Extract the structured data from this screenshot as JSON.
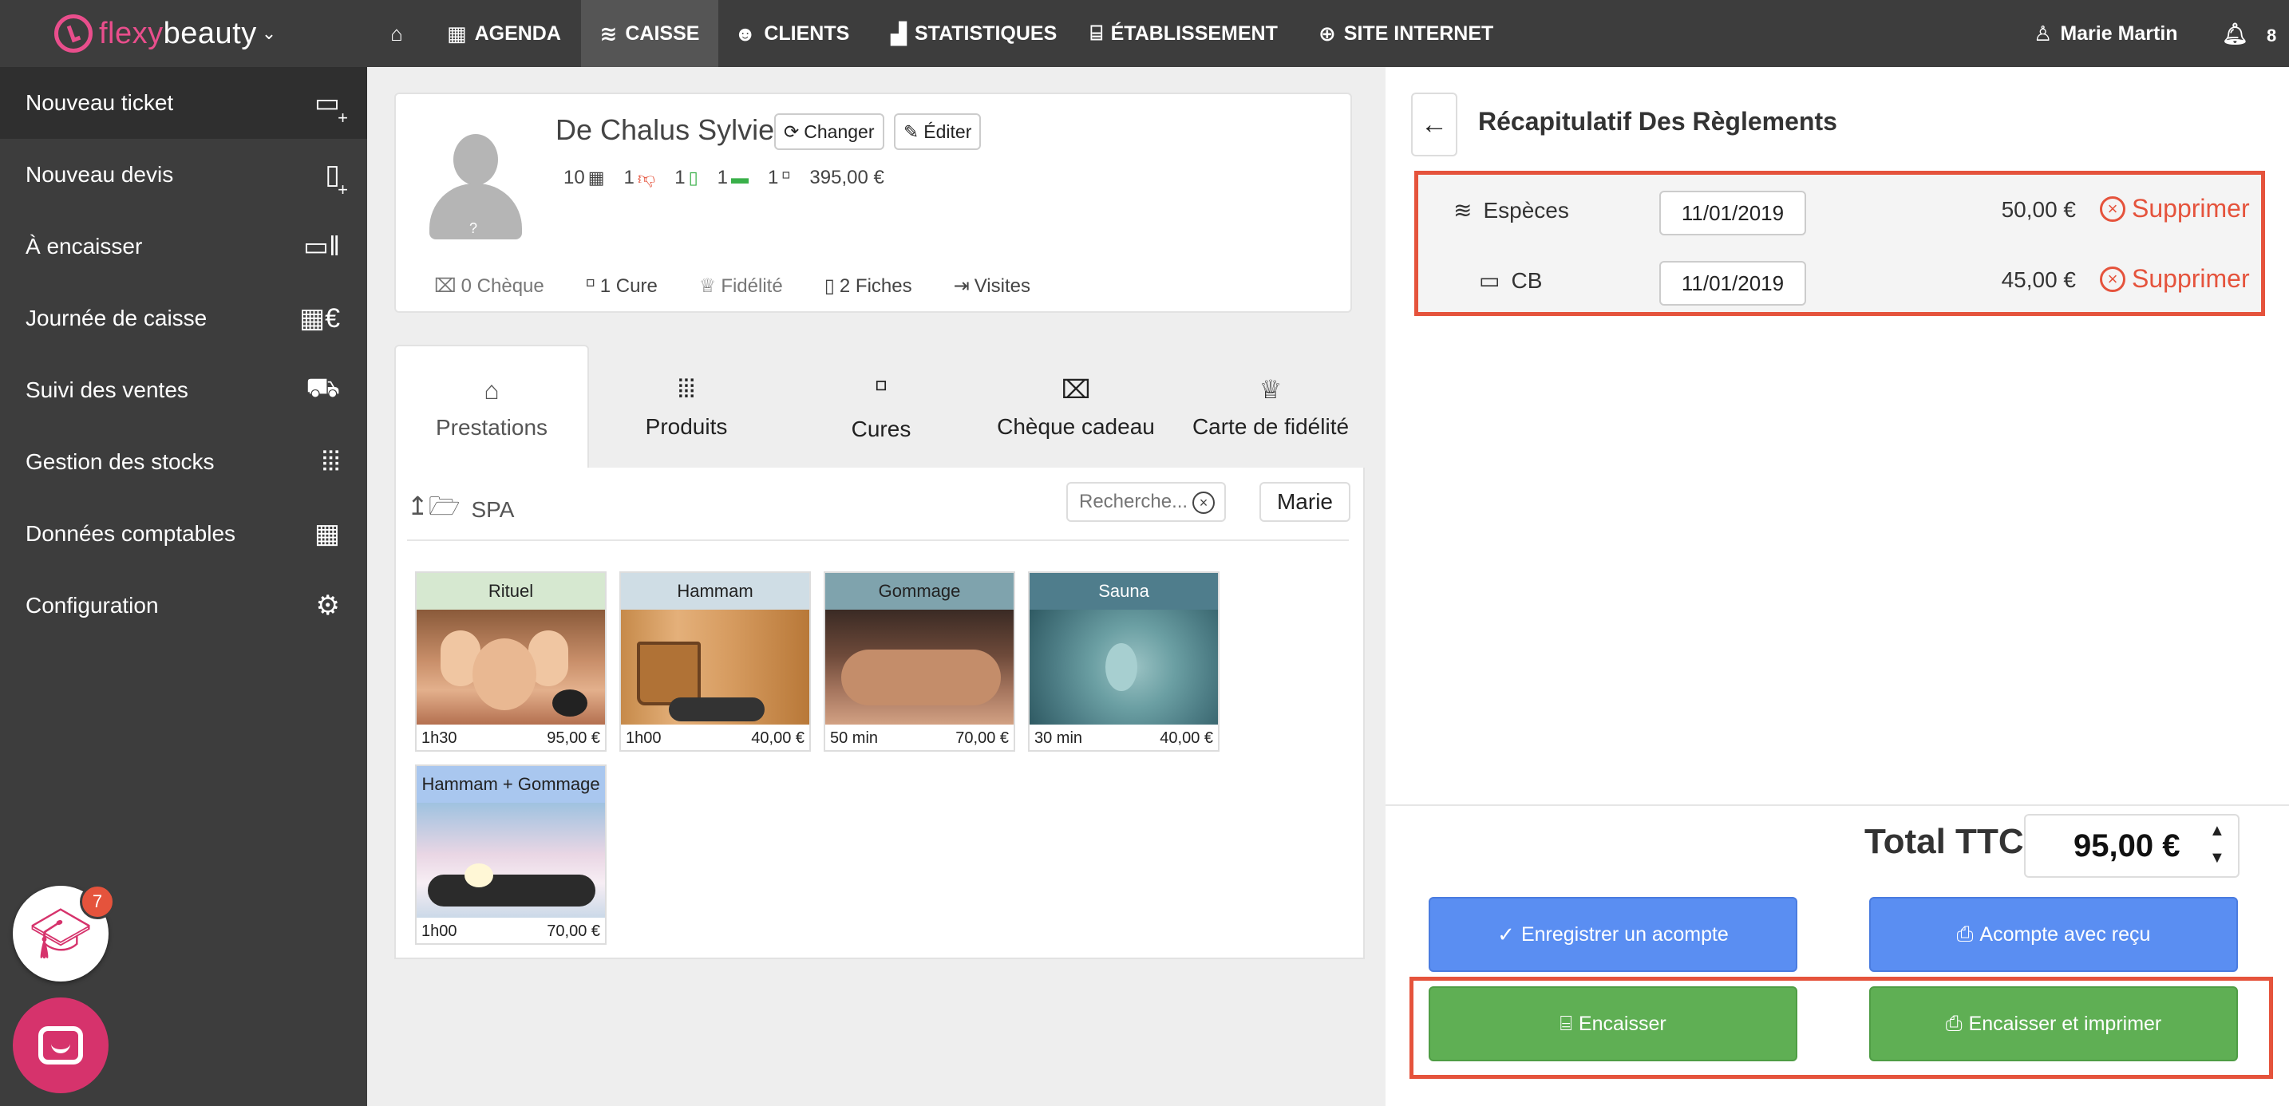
{
  "brand": {
    "part1": "flexy",
    "part2": "beauty",
    "caret": "⌄",
    "accent": "#e94e8c"
  },
  "nav": {
    "home_icon": "home-icon",
    "items": [
      {
        "label": "AGENDA",
        "icon": "calendar-icon"
      },
      {
        "label": "CAISSE",
        "icon": "coins-icon"
      },
      {
        "label": "CLIENTS",
        "icon": "users-icon"
      },
      {
        "label": "STATISTIQUES",
        "icon": "chart-icon"
      },
      {
        "label": "ÉTABLISSEMENT",
        "icon": "store-icon"
      },
      {
        "label": "SITE INTERNET",
        "icon": "globe-icon"
      }
    ],
    "active": "CAISSE",
    "user": "Marie Martin",
    "notifications": "8"
  },
  "sidebar": {
    "items": [
      {
        "label": "Nouveau ticket",
        "icon": "register-plus-icon"
      },
      {
        "label": "Nouveau devis",
        "icon": "document-plus-icon"
      },
      {
        "label": "À encaisser",
        "icon": "register-pause-icon"
      },
      {
        "label": "Journée de caisse",
        "icon": "calendar-euro-icon"
      },
      {
        "label": "Suivi des ventes",
        "icon": "cart-icon"
      },
      {
        "label": "Gestion des stocks",
        "icon": "barcode-icon"
      },
      {
        "label": "Données comptables",
        "icon": "calculator-icon"
      },
      {
        "label": "Configuration",
        "icon": "gears-icon"
      }
    ],
    "edu_badge": "7"
  },
  "client": {
    "name": "De Chalus Sylvie",
    "avatar_mark": "?",
    "change_label": "Changer",
    "edit_label": "Éditer",
    "stats": {
      "visits": "10",
      "cancelled": "1",
      "documents": "1",
      "tickets": "1",
      "cures": "1",
      "total": "395,00 €"
    },
    "links": {
      "cheque": "0 Chèque",
      "cure": "1 Cure",
      "fidelite": "Fidélité",
      "fiches": "2 Fiches",
      "visites": "Visites"
    }
  },
  "catalog": {
    "tabs": [
      {
        "label": "Prestations",
        "icon": "tag-icon"
      },
      {
        "label": "Produits",
        "icon": "barcode-icon"
      },
      {
        "label": "Cures",
        "icon": "hierarchy-icon"
      },
      {
        "label": "Chèque cadeau",
        "icon": "gift-icon"
      },
      {
        "label": "Carte de fidélité",
        "icon": "trophy-icon"
      }
    ],
    "folder": "SPA",
    "search_placeholder": "Recherche...",
    "staff": "Marie",
    "products": [
      {
        "name": "Rituel",
        "duration": "1h30",
        "price": "95,00 €",
        "header_color": "#d6e8d0"
      },
      {
        "name": "Hammam",
        "duration": "1h00",
        "price": "40,00 €",
        "header_color": "#cfdde5"
      },
      {
        "name": "Gommage",
        "duration": "50 min",
        "price": "70,00 €",
        "header_color": "#7fa3ad"
      },
      {
        "name": "Sauna",
        "duration": "30 min",
        "price": "40,00 €",
        "header_color": "#4f7d8c"
      },
      {
        "name": "Hammam + Gommage",
        "duration": "1h00",
        "price": "70,00 €",
        "header_color": "#a9c7ef"
      }
    ]
  },
  "payment": {
    "title": "Récapitulatif Des Règlements",
    "rows": [
      {
        "method": "Espèces",
        "icon": "coins-icon",
        "date": "11/01/2019",
        "amount": "50,00 €",
        "delete_label": "Supprimer"
      },
      {
        "method": "CB",
        "icon": "credit-card-icon",
        "date": "11/01/2019",
        "amount": "45,00 €",
        "delete_label": "Supprimer"
      }
    ],
    "total_label": "Total TTC",
    "total_value": "95,00 €",
    "buttons": {
      "acompte": "Enregistrer un acompte",
      "acompte_recu": "Acompte avec reçu",
      "encaisser": "Encaisser",
      "encaisser_imprimer": "Encaisser et imprimer"
    },
    "highlight_color": "#e5533c"
  }
}
